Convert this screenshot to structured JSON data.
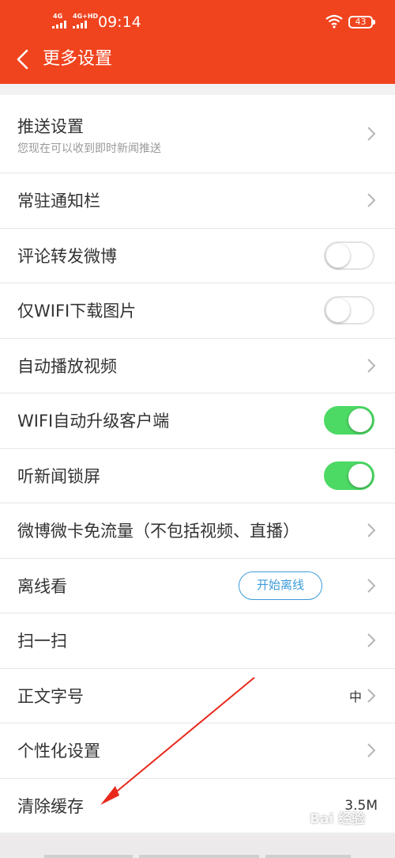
{
  "status_bar": {
    "signal_1": "4G",
    "signal_2": "4G+HD",
    "time": "09:14",
    "battery": "43"
  },
  "header": {
    "title": "更多设置"
  },
  "settings": {
    "push": {
      "label": "推送设置",
      "subtitle": "您现在可以收到即时新闻推送"
    },
    "persistent_notification": {
      "label": "常驻通知栏"
    },
    "comment_repost_weibo": {
      "label": "评论转发微博",
      "enabled": false
    },
    "wifi_only_images": {
      "label": "仅WIFI下载图片",
      "enabled": false
    },
    "autoplay_video": {
      "label": "自动播放视频"
    },
    "wifi_auto_upgrade": {
      "label": "WIFI自动升级客户端",
      "enabled": true
    },
    "listen_news_lock_screen": {
      "label": "听新闻锁屏",
      "enabled": true
    },
    "weibo_card_free_data": {
      "label": "微博微卡免流量（不包括视频、直播）"
    },
    "offline_reading": {
      "label": "离线看",
      "button": "开始离线"
    },
    "scan": {
      "label": "扫一扫"
    },
    "font_size": {
      "label": "正文字号",
      "value": "中"
    },
    "personalization": {
      "label": "个性化设置"
    },
    "clear_cache": {
      "label": "清除缓存",
      "value": "3.5M"
    }
  },
  "watermark": {
    "text": "Bai 经验"
  },
  "colors": {
    "header_bg": "#f0441f",
    "toggle_on": "#4cd964",
    "pill_blue": "#3d9bd9",
    "annotation_arrow": "#e8291c"
  }
}
